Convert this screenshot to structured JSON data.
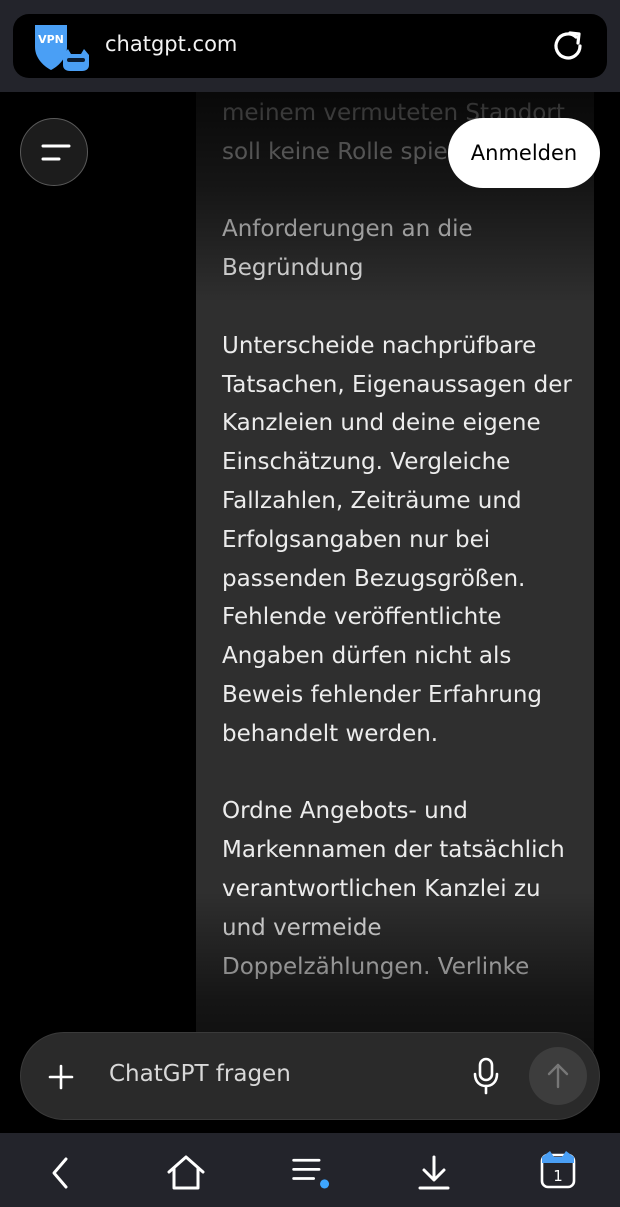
{
  "browser": {
    "url": "chatgpt.com",
    "vpn_badge": "VPN",
    "tab_count": "1"
  },
  "header": {
    "login_label": "Anmelden"
  },
  "message": {
    "paragraphs": [
      "meinem vermuteten Standort soll keine Rolle spielen.",
      "Anforderungen an die Begründung",
      "Unterscheide nachprüfbare Tatsachen, Eigenaussagen der Kanzleien und deine eigene Einschätzung. Vergleiche Fallzahlen, Zeiträume und Erfolgsangaben nur bei passenden Bezugsgrößen. Fehlende veröffentlichte Angaben dürfen nicht als Beweis fehlender Erfahrung behandelt werden.",
      "Ordne Angebots- und Markennamen der tatsächlich verantwortlichen Kanzlei zu und vermeide Doppelzählungen. Verlinke"
    ]
  },
  "composer": {
    "placeholder": "ChatGPT fragen"
  },
  "icons": [
    "vpn-icon",
    "reload-icon",
    "menu-icon",
    "plus-icon",
    "mic-icon",
    "send-arrow-icon",
    "back-icon",
    "home-icon",
    "tabs-menu-icon",
    "download-icon",
    "tab-counter-icon"
  ],
  "colors": {
    "topbar": "#23242b",
    "vpn_blue": "#4a9ff5",
    "bubble": "#2f2f2f",
    "notification_dot": "#3ea6ff"
  }
}
